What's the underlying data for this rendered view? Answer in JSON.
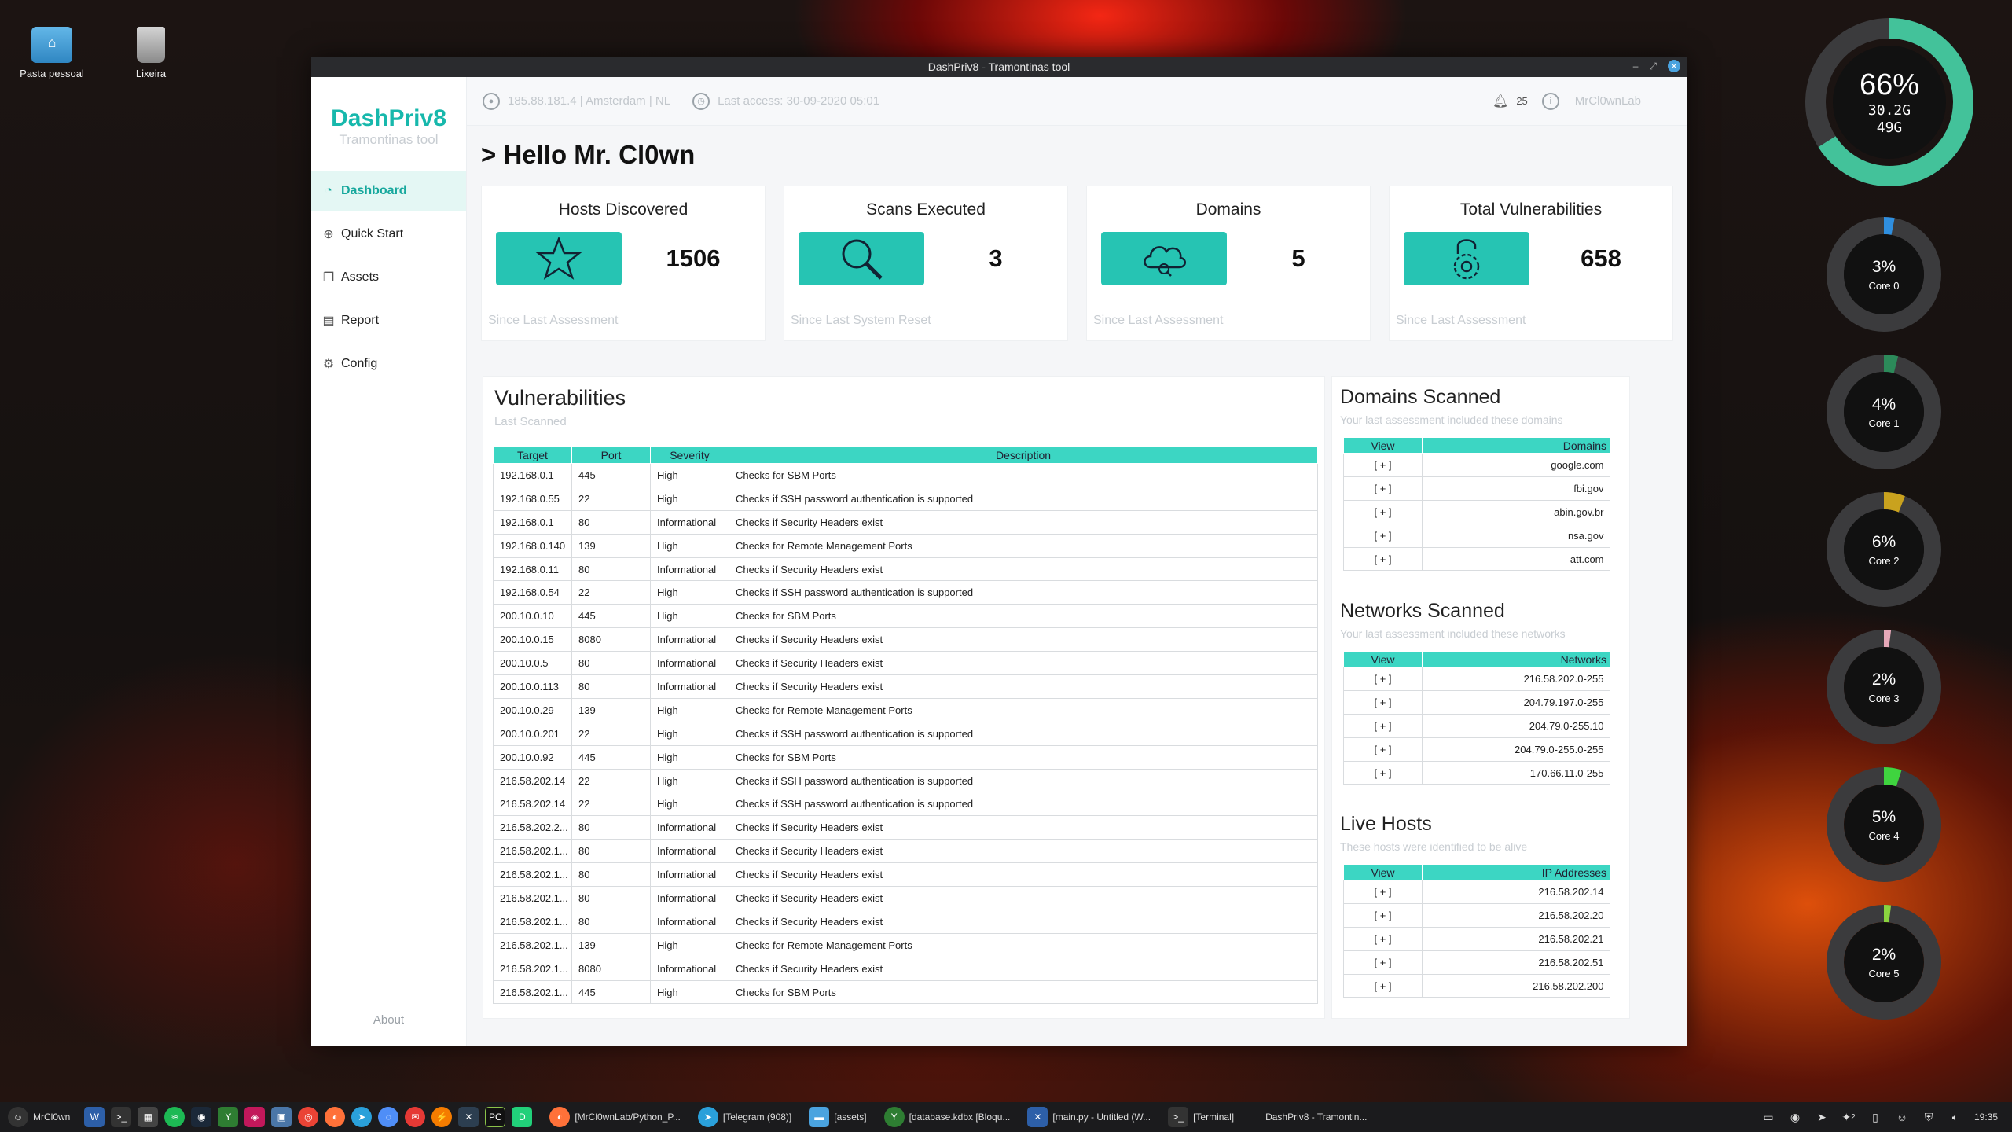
{
  "desktop": {
    "icons": [
      {
        "label": "Pasta pessoal"
      },
      {
        "label": "Lixeira"
      }
    ]
  },
  "window": {
    "title": "DashPriv8 - Tramontinas tool"
  },
  "sidebar": {
    "brand": "DashPriv8",
    "subtitle": "Tramontinas tool",
    "items": [
      {
        "label": "Dashboard",
        "icon": "dashboard-icon",
        "active": true
      },
      {
        "label": "Quick Start",
        "icon": "plus-circle-icon"
      },
      {
        "label": "Assets",
        "icon": "assets-icon"
      },
      {
        "label": "Report",
        "icon": "report-icon"
      },
      {
        "label": "Config",
        "icon": "gear-icon"
      }
    ],
    "about": "About"
  },
  "topbar": {
    "ip_info": "185.88.181.4  | Amsterdam | NL",
    "last_access": "Last access: 30-09-2020 05:01",
    "notifications": "25",
    "user": "MrCl0wnLab"
  },
  "greeting": "> Hello Mr. Cl0wn",
  "cards": [
    {
      "title": "Hosts Discovered",
      "value": "1506",
      "footer": "Since Last Assessment",
      "icon": "star-icon"
    },
    {
      "title": "Scans Executed",
      "value": "3",
      "footer": "Since Last System Reset",
      "icon": "search-icon"
    },
    {
      "title": "Domains",
      "value": "5",
      "footer": "Since Last Assessment",
      "icon": "cloud-icon"
    },
    {
      "title": "Total Vulnerabilities",
      "value": "658",
      "footer": "Since Last Assessment",
      "icon": "lock-gear-icon"
    }
  ],
  "vulnerabilities": {
    "title": "Vulnerabilities",
    "subtitle": "Last Scanned",
    "columns": [
      "Target",
      "Port",
      "Severity",
      "Description"
    ],
    "rows": [
      [
        "192.168.0.1",
        "445",
        "High",
        "Checks for SBM Ports"
      ],
      [
        "192.168.0.55",
        "22",
        "High",
        "Checks if SSH password authentication is supported"
      ],
      [
        "192.168.0.1",
        "80",
        "Informational",
        "Checks if Security Headers exist"
      ],
      [
        "192.168.0.140",
        "139",
        "High",
        "Checks for Remote Management Ports"
      ],
      [
        "192.168.0.11",
        "80",
        "Informational",
        "Checks if Security Headers exist"
      ],
      [
        "192.168.0.54",
        "22",
        "High",
        "Checks if SSH password authentication is supported"
      ],
      [
        "200.10.0.10",
        "445",
        "High",
        "Checks for SBM Ports"
      ],
      [
        "200.10.0.15",
        "8080",
        "Informational",
        "Checks if Security Headers exist"
      ],
      [
        "200.10.0.5",
        "80",
        "Informational",
        "Checks if Security Headers exist"
      ],
      [
        "200.10.0.113",
        "80",
        "Informational",
        "Checks if Security Headers exist"
      ],
      [
        "200.10.0.29",
        "139",
        "High",
        "Checks for Remote Management Ports"
      ],
      [
        "200.10.0.201",
        "22",
        "High",
        "Checks if SSH password authentication is supported"
      ],
      [
        "200.10.0.92",
        "445",
        "High",
        "Checks for SBM Ports"
      ],
      [
        "216.58.202.14",
        "22",
        "High",
        "Checks if SSH password authentication is supported"
      ],
      [
        "216.58.202.14",
        "22",
        "High",
        "Checks if SSH password authentication is supported"
      ],
      [
        "216.58.202.2...",
        "80",
        "Informational",
        "Checks if Security Headers exist"
      ],
      [
        "216.58.202.1...",
        "80",
        "Informational",
        "Checks if Security Headers exist"
      ],
      [
        "216.58.202.1...",
        "80",
        "Informational",
        "Checks if Security Headers exist"
      ],
      [
        "216.58.202.1...",
        "80",
        "Informational",
        "Checks if Security Headers exist"
      ],
      [
        "216.58.202.1...",
        "80",
        "Informational",
        "Checks if Security Headers exist"
      ],
      [
        "216.58.202.1...",
        "139",
        "High",
        "Checks for Remote Management Ports"
      ],
      [
        "216.58.202.1...",
        "8080",
        "Informational",
        "Checks if Security Headers exist"
      ],
      [
        "216.58.202.1...",
        "445",
        "High",
        "Checks for SBM Ports"
      ]
    ]
  },
  "domains_scanned": {
    "title": "Domains Scanned",
    "subtitle": "Your last assessment included these domains",
    "columns": [
      "View",
      "Domains"
    ],
    "rows": [
      [
        "[ + ]",
        "google.com"
      ],
      [
        "[ + ]",
        "fbi.gov"
      ],
      [
        "[ + ]",
        "abin.gov.br"
      ],
      [
        "[ + ]",
        "nsa.gov"
      ],
      [
        "[ + ]",
        "att.com"
      ]
    ]
  },
  "networks_scanned": {
    "title": "Networks Scanned",
    "subtitle": "Your last assessment included these networks",
    "columns": [
      "View",
      "Networks"
    ],
    "rows": [
      [
        "[ + ]",
        "216.58.202.0-255"
      ],
      [
        "[ + ]",
        "204.79.197.0-255"
      ],
      [
        "[ + ]",
        "204.79.0-255.10"
      ],
      [
        "[ + ]",
        "204.79.0-255.0-255"
      ],
      [
        "[ + ]",
        "170.66.11.0-255"
      ]
    ]
  },
  "live_hosts": {
    "title": "Live Hosts",
    "subtitle": "These hosts were identified to be alive",
    "columns": [
      "View",
      "IP Addresses"
    ],
    "rows": [
      [
        "[ + ]",
        "216.58.202.14"
      ],
      [
        "[ + ]",
        "216.58.202.20"
      ],
      [
        "[ + ]",
        "216.58.202.21"
      ],
      [
        "[ + ]",
        "216.58.202.51"
      ],
      [
        "[ + ]",
        "216.58.202.200"
      ]
    ]
  },
  "conky": {
    "memory": {
      "percent_label": "66%",
      "used": "30.2G",
      "total": "49G",
      "fraction": 0.66,
      "color": "#43c29a"
    },
    "cores": [
      {
        "percent_label": "3%",
        "label": "Core 0",
        "fraction": 0.03,
        "color": "#2f8fe0"
      },
      {
        "percent_label": "4%",
        "label": "Core 1",
        "fraction": 0.04,
        "color": "#2c8a5a"
      },
      {
        "percent_label": "6%",
        "label": "Core 2",
        "fraction": 0.06,
        "color": "#c9a21e"
      },
      {
        "percent_label": "2%",
        "label": "Core 3",
        "fraction": 0.02,
        "color": "#e6a8b8"
      },
      {
        "percent_label": "5%",
        "label": "Core 4",
        "fraction": 0.05,
        "color": "#3fd43f"
      },
      {
        "percent_label": "2%",
        "label": "Core 5",
        "fraction": 0.02,
        "color": "#8ad43f"
      }
    ]
  },
  "taskbar": {
    "user": "MrCl0wn",
    "tasks": [
      "[MrCl0wnLab/Python_P...",
      "[Telegram (908)]",
      "[assets]",
      "[database.kdbx [Bloqu...",
      "[main.py - Untitled (W...",
      "[Terminal]",
      "DashPriv8 - Tramontin..."
    ],
    "tray_badge": "2",
    "clock": "19:35"
  }
}
